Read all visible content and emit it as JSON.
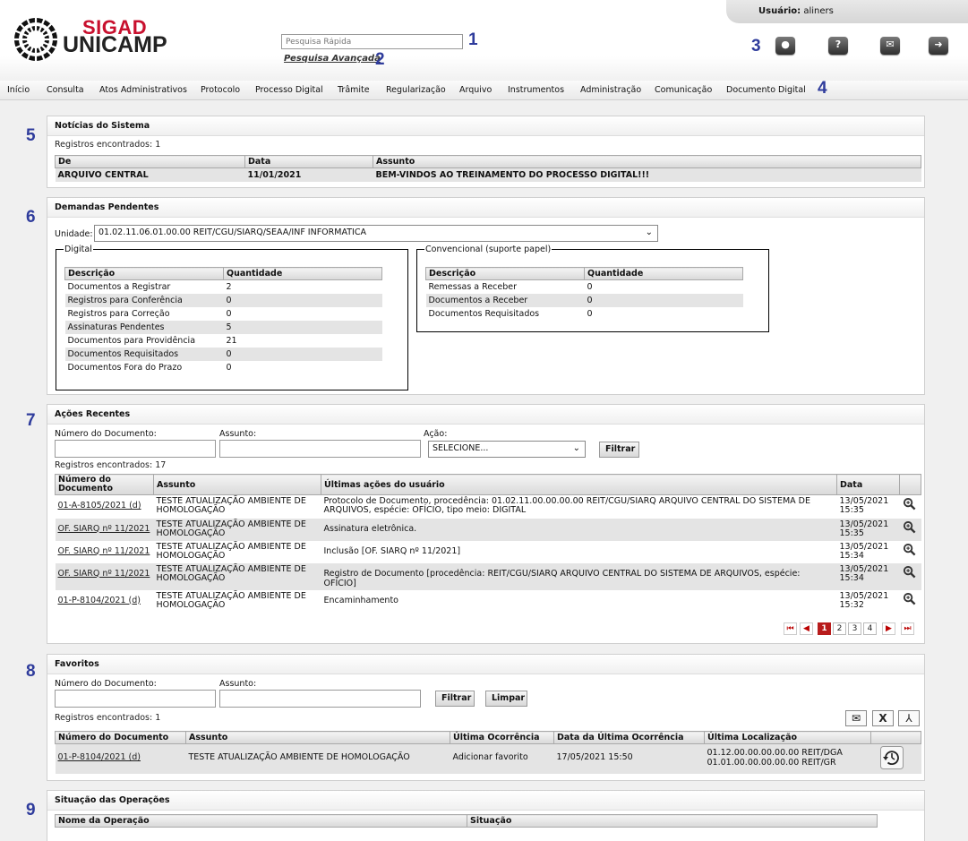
{
  "header": {
    "user_label": "Usuário:",
    "user_name": "aliners",
    "logo_line1": "SIGAD",
    "logo_line2": "UNICAMP",
    "quick_search_placeholder": "Pesquisa Rápida",
    "advanced_search": "Pesquisa Avançada",
    "icons": [
      "user-icon",
      "help-icon",
      "chat-icon",
      "exit-icon"
    ]
  },
  "callouts": [
    "1",
    "2",
    "3",
    "4",
    "5",
    "6",
    "7",
    "8",
    "9"
  ],
  "nav": {
    "items": [
      "Início",
      "Consulta",
      "Atos Administrativos",
      "Protocolo",
      "Processo Digital",
      "Trâmite",
      "Regularização",
      "Arquivo",
      "Instrumentos",
      "Administração",
      "Comunicação",
      "Documento Digital"
    ]
  },
  "news": {
    "title": "Notícias do Sistema",
    "records": "Registros encontrados: 1",
    "headers": [
      "De",
      "Data",
      "Assunto"
    ],
    "rows": [
      [
        "ARQUIVO CENTRAL",
        "11/01/2021",
        "BEM-VINDOS AO TREINAMENTO DO PROCESSO DIGITAL!!!"
      ]
    ]
  },
  "pending": {
    "title": "Demandas Pendentes",
    "unit_label": "Unidade:",
    "unit_value": "01.02.11.06.01.00.00 REIT/CGU/SIARQ/SEAA/INF INFORMATICA",
    "digital": {
      "legend": "Digital",
      "headers": [
        "Descrição",
        "Quantidade"
      ],
      "rows": [
        [
          "Documentos a Registrar",
          "2"
        ],
        [
          "Registros para Conferência",
          "0"
        ],
        [
          "Registros para Correção",
          "0"
        ],
        [
          "Assinaturas Pendentes",
          "5"
        ],
        [
          "Documentos para Providência",
          "21"
        ],
        [
          "Documentos Requisitados",
          "0"
        ],
        [
          "Documentos Fora do Prazo",
          "0"
        ]
      ]
    },
    "conventional": {
      "legend": "Convencional (suporte papel)",
      "headers": [
        "Descrição",
        "Quantidade"
      ],
      "rows": [
        [
          "Remessas a Receber",
          "0"
        ],
        [
          "Documentos a Receber",
          "0"
        ],
        [
          "Documentos Requisitados",
          "0"
        ]
      ]
    }
  },
  "recent": {
    "title": "Ações Recentes",
    "doc_label": "Número do Documento:",
    "subject_label": "Assunto:",
    "action_label": "Ação:",
    "action_value": "SELECIONE...",
    "filter_button": "Filtrar",
    "records": "Registros encontrados: 17",
    "headers": [
      "Número do Documento",
      "Assunto",
      "Últimas ações do usuário",
      "Data",
      ""
    ],
    "rows": [
      [
        "01-A-8105/2021 (d)",
        "TESTE ATUALIZAÇÃO AMBIENTE DE HOMOLOGAÇÃO",
        "Protocolo de Documento, procedência: 01.02.11.00.00.00.00 REIT/CGU/SIARQ ARQUIVO CENTRAL DO SISTEMA DE ARQUIVOS, espécie: OFÍCIO, tipo meio: DIGITAL",
        "13/05/2021 15:35"
      ],
      [
        "OF. SIARQ nº 11/2021",
        "TESTE ATUALIZAÇÃO AMBIENTE DE HOMOLOGAÇÃO",
        "Assinatura eletrônica.",
        "13/05/2021 15:35"
      ],
      [
        "OF. SIARQ nº 11/2021",
        "TESTE ATUALIZAÇÃO AMBIENTE DE HOMOLOGAÇÃO",
        "Inclusão [OF. SIARQ nº 11/2021]",
        "13/05/2021 15:34"
      ],
      [
        "OF. SIARQ nº 11/2021",
        "TESTE ATUALIZAÇÃO AMBIENTE DE HOMOLOGAÇÃO",
        "Registro de Documento [procedência: REIT/CGU/SIARQ ARQUIVO CENTRAL DO SISTEMA DE ARQUIVOS, espécie: OFÍCIO]",
        "13/05/2021 15:34"
      ],
      [
        "01-P-8104/2021 (d)",
        "TESTE ATUALIZAÇÃO AMBIENTE DE HOMOLOGAÇÃO",
        "Encaminhamento",
        "13/05/2021 15:32"
      ]
    ],
    "pages": [
      "1",
      "2",
      "3",
      "4"
    ],
    "current_page": "1"
  },
  "favorites": {
    "title": "Favoritos",
    "doc_label": "Número do Documento:",
    "subject_label": "Assunto:",
    "filter_button": "Filtrar",
    "clear_button": "Limpar",
    "records": "Registros encontrados: 1",
    "export_icons": [
      "email-icon",
      "excel-icon",
      "pdf-icon"
    ],
    "headers": [
      "Número do Documento",
      "Assunto",
      "Última Ocorrência",
      "Data da Última Ocorrência",
      "Última Localização",
      ""
    ],
    "rows": [
      [
        "01-P-8104/2021 (d)",
        "TESTE ATUALIZAÇÃO AMBIENTE DE HOMOLOGAÇÃO",
        "Adicionar favorito",
        "17/05/2021 15:50",
        "01.12.00.00.00.00.00 REIT/DGA 01.01.00.00.00.00.00 REIT/GR"
      ]
    ]
  },
  "operations": {
    "title": "Situação das Operações",
    "headers": [
      "Nome da Operação",
      "Situação"
    ]
  }
}
